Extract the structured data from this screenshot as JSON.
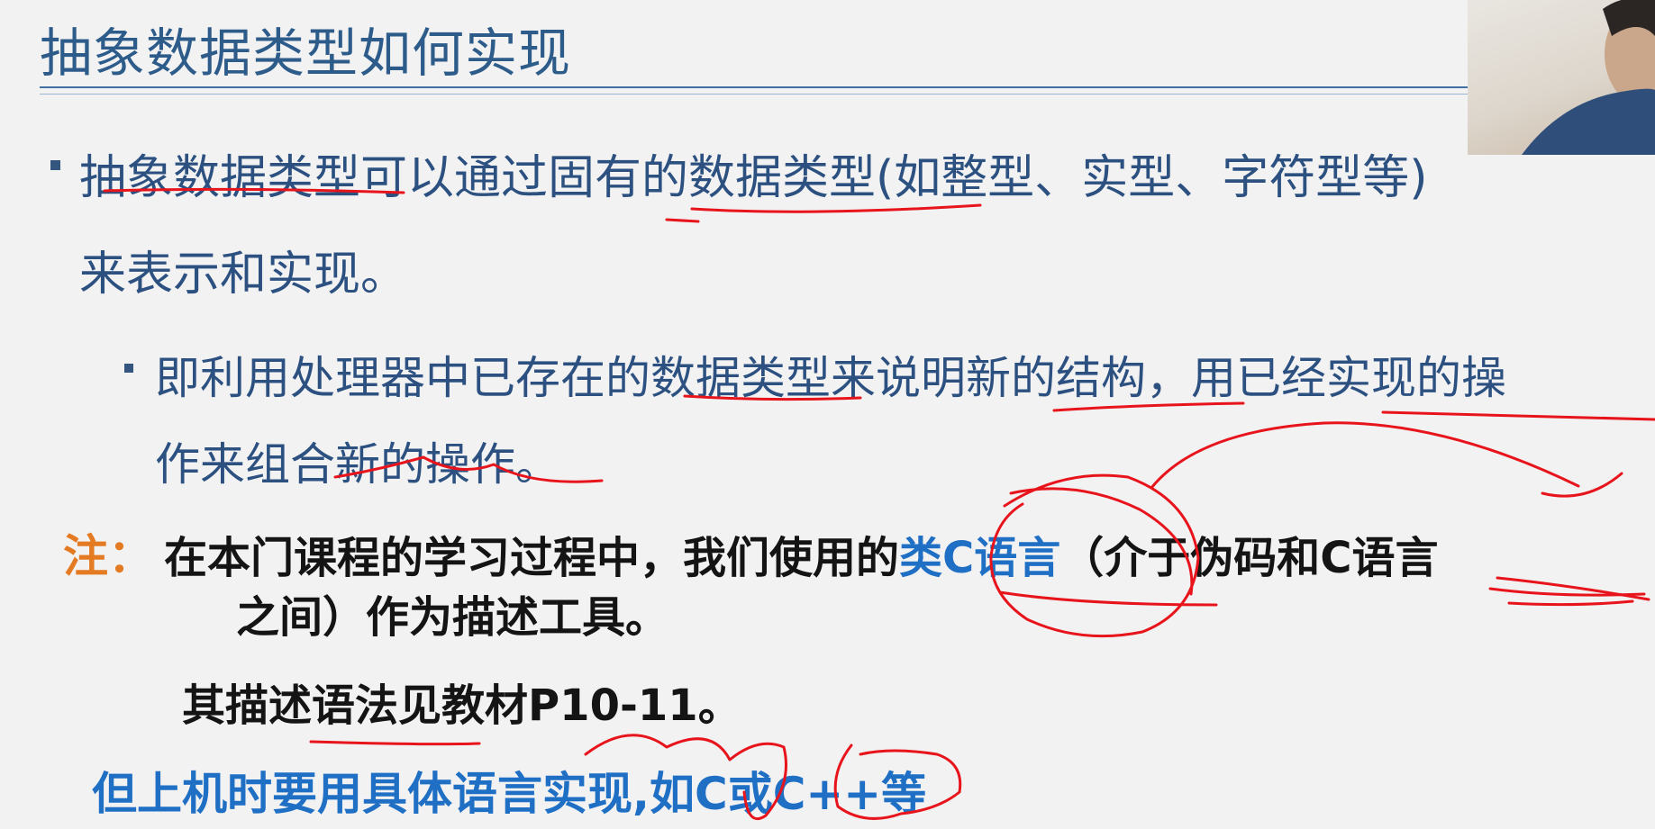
{
  "title": "抽象数据类型如何实现",
  "bullet1": {
    "line1": "抽象数据类型可以通过固有的数据类型(如整型、实型、字符型等)",
    "line2": "来表示和实现。"
  },
  "bullet2": {
    "line1": "即利用处理器中已存在的数据类型来说明新的结构，用已经实现的操",
    "line2": "作来组合新的操作。"
  },
  "note": {
    "label": "注：",
    "line1_pre": "在本门课程的学习过程中，我们使用的",
    "line1_highlight": "类C语言",
    "line1_post": "（介于伪码和C语言",
    "line2": "之间）作为描述工具。",
    "line3": "其描述语法见教材P10-11。"
  },
  "footer_line": "但上机时要用具体语言实现,如C或C++等",
  "colors": {
    "title": "#2e5c8a",
    "body_text": "#2c5181",
    "note_label": "#e47a21",
    "highlight": "#1f6fc4",
    "annotation_ink": "#e8141b"
  }
}
